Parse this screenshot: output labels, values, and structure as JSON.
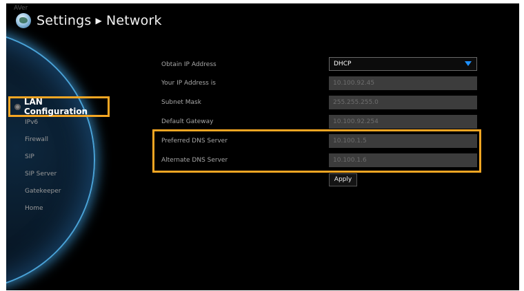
{
  "brand": "AVer",
  "header": {
    "title": "Settings",
    "separator": "▶",
    "subtitle": "Network",
    "icon": "globe-icon"
  },
  "sidebar": {
    "active_label": "LAN Configuration",
    "items": [
      {
        "label": "IPv6"
      },
      {
        "label": "Firewall"
      },
      {
        "label": "SIP"
      },
      {
        "label": "SIP Server"
      },
      {
        "label": "Gatekeeper"
      },
      {
        "label": "Home"
      }
    ]
  },
  "form": {
    "obtain_ip": {
      "label": "Obtain IP Address",
      "value": "DHCP"
    },
    "your_ip": {
      "label": "Your IP Address is",
      "value": "10.100.92.45"
    },
    "subnet": {
      "label": "Subnet Mask",
      "value": "255.255.255.0"
    },
    "gateway": {
      "label": "Default Gateway",
      "value": "10.100.92.254"
    },
    "preferred_dns": {
      "label": "Preferred DNS Server",
      "value": "10.100.1.5"
    },
    "alternate_dns": {
      "label": "Alternate DNS Server",
      "value": "10.100.1.6"
    },
    "apply_label": "Apply"
  },
  "colors": {
    "highlight": "#f5a623",
    "accent": "#1e90ff",
    "background": "#000000"
  }
}
